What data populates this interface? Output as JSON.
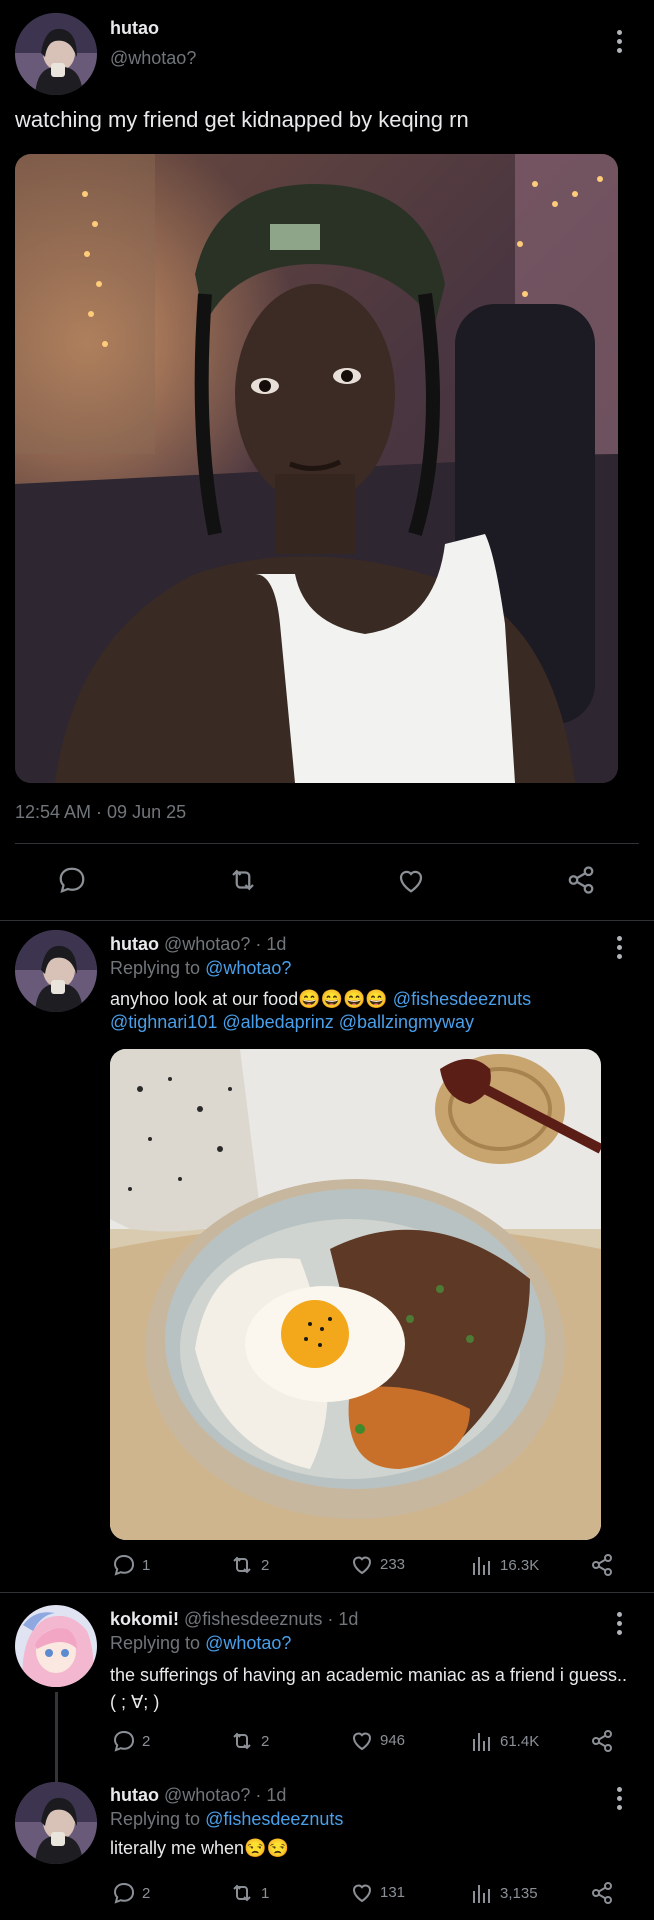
{
  "colors": {
    "background": "#000000",
    "link": "#4a9fea",
    "muted": "#71767b",
    "text": "#e7e9ea"
  },
  "main_tweet": {
    "author_name": "hutao",
    "author_handle": "@whotao?",
    "text": "watching my friend get kidnapped by keqing rn",
    "timestamp": "12:54 AM · 09 Jun 25",
    "actions": [
      "comment-icon",
      "retweet-icon",
      "like-icon",
      "share-icon"
    ]
  },
  "reply1": {
    "author_name": "hutao",
    "handle_time": "@whotao? · 1d",
    "replying_prefix": "Replying to ",
    "replying_to": "@whotao?",
    "text_start": "anyhoo look at our food😄😄😄😄 ",
    "mention1": "@fishesdeeznuts",
    "mention2": "@tighnari101",
    "mention3": "@albedaprinz",
    "mention4": "@ballzingmyway",
    "replies": "1",
    "retweets": "2",
    "likes": "233",
    "views": "16.3K"
  },
  "reply2": {
    "author_name": "kokomi!",
    "handle_time": "@fishesdeeznuts · 1d",
    "replying_prefix": "Replying to ",
    "replying_to": "@whotao?",
    "text_line1": "the sufferings of having an academic maniac as a friend i guess..",
    "text_line2": "( ; ∀; )",
    "replies": "2",
    "retweets": "2",
    "likes": "946",
    "views": "61.4K"
  },
  "reply3": {
    "author_name": "hutao",
    "handle_time": "@whotao? · 1d",
    "replying_prefix": "Replying to ",
    "replying_to": "@fishesdeeznuts",
    "text": "literally me when😒😒",
    "replies": "2",
    "retweets": "1",
    "likes": "131",
    "views": "3,135"
  }
}
